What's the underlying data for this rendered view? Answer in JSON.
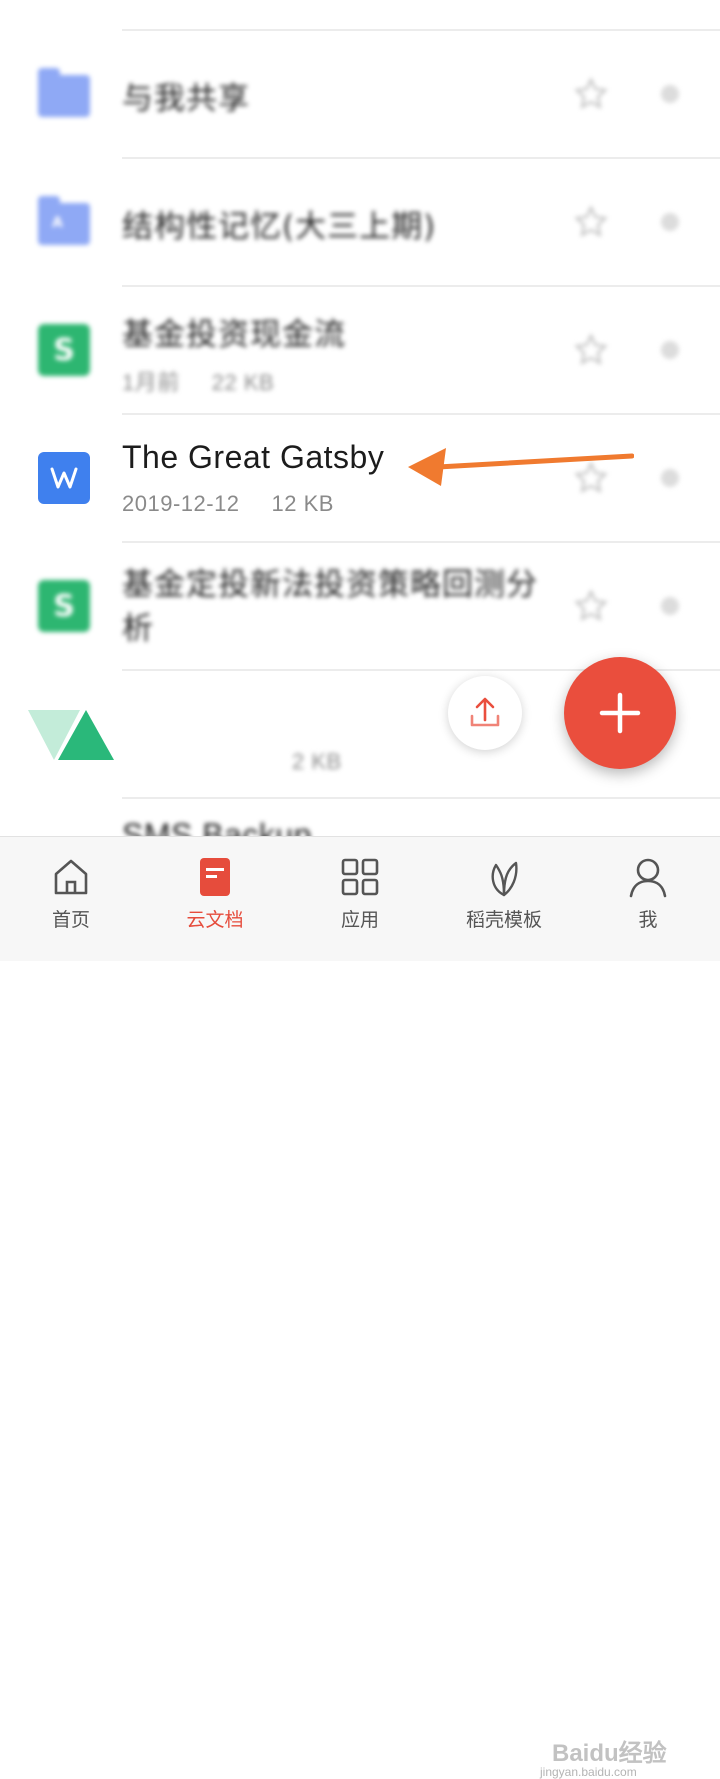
{
  "files": [
    {
      "name": "与我共享",
      "type": "folder"
    },
    {
      "name": "结构性记忆(大三上期)",
      "type": "folder"
    },
    {
      "name": "基金投资现金流",
      "type": "sheet",
      "date": "1月前",
      "size": "22 KB"
    },
    {
      "name": "The Great Gatsby",
      "type": "doc",
      "date": "2019-12-12",
      "size": "12 KB"
    },
    {
      "name": "基金定投新法投资策略回测分析",
      "type": "sheet"
    },
    {
      "size": "2 KB"
    },
    {
      "name": "SMS Backup"
    }
  ],
  "fab": {
    "color": "#ea4e3d"
  },
  "accent": "#e64c3c",
  "tabs": [
    {
      "label": "首页",
      "icon": "home-icon"
    },
    {
      "label": "云文档",
      "icon": "cloud-doc-icon",
      "active": true
    },
    {
      "label": "应用",
      "icon": "grid-apps-icon"
    },
    {
      "label": "稻壳模板",
      "icon": "leaf-icon"
    },
    {
      "label": "我",
      "icon": "user-icon"
    }
  ],
  "watermark": {
    "main": "Baidu经验",
    "sub": "jingyan.baidu.com"
  }
}
